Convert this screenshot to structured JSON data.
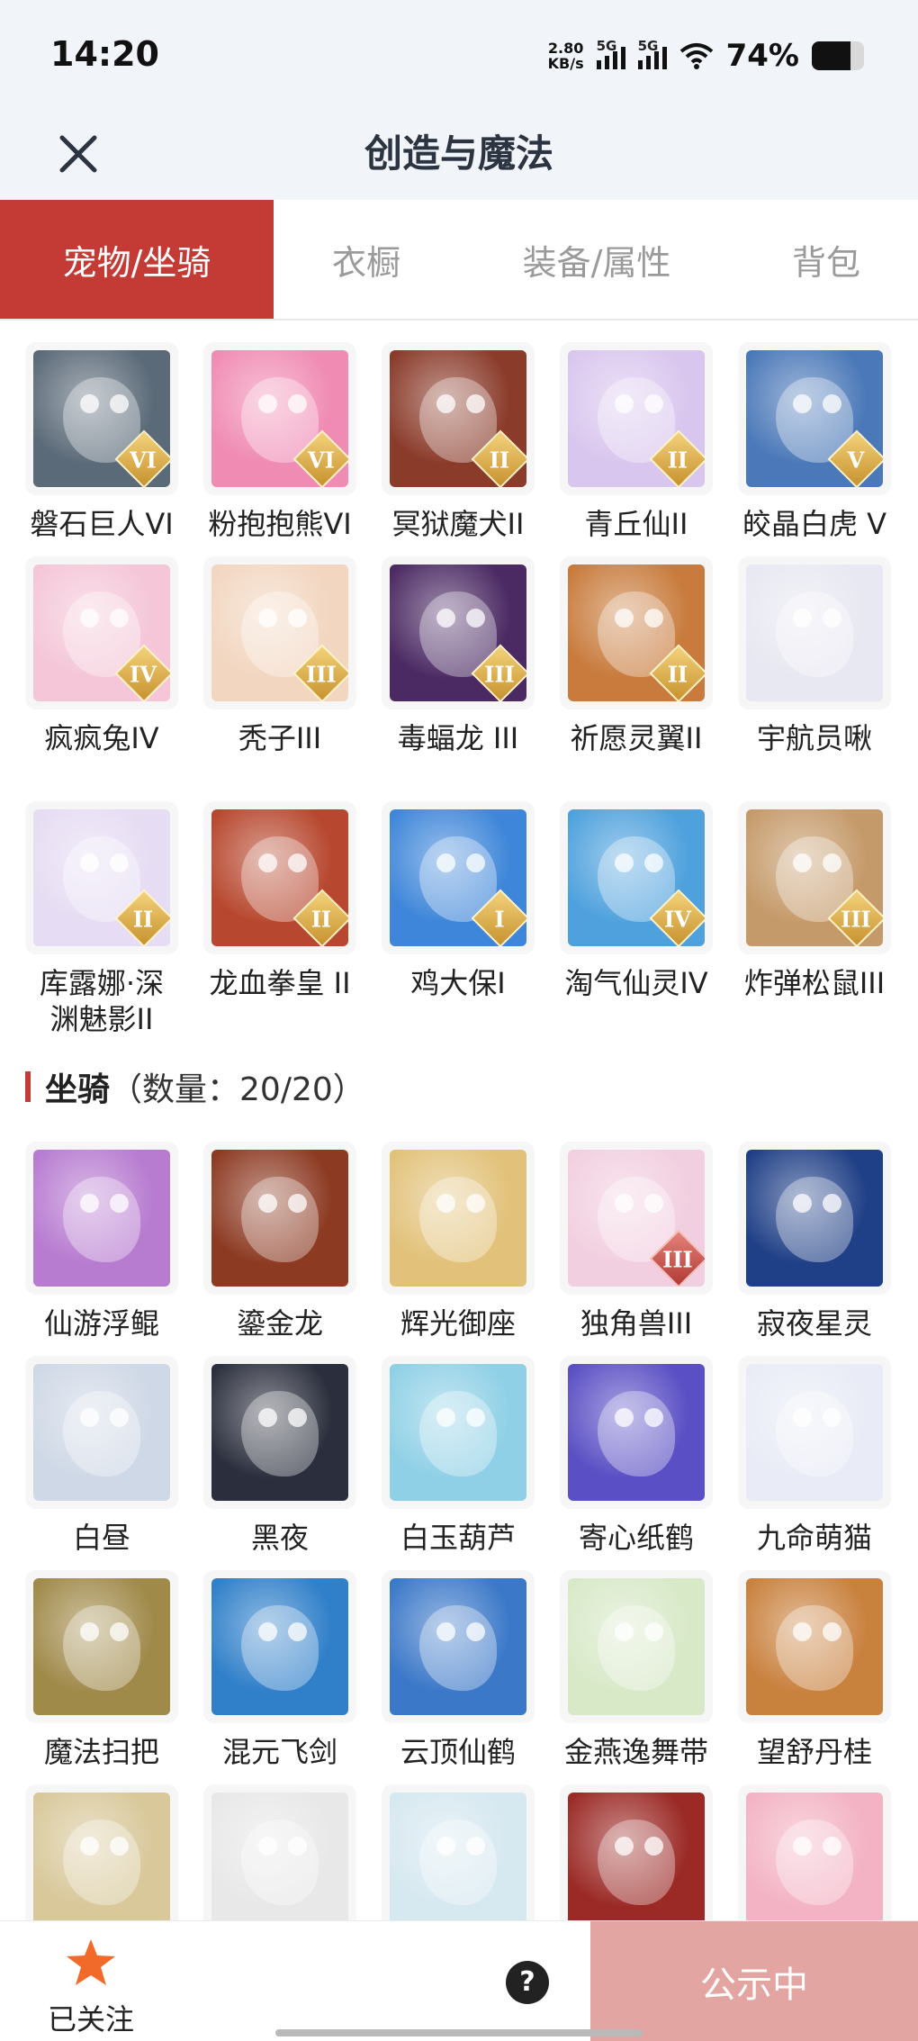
{
  "status_bar": {
    "time": "14:20",
    "net_speed_value": "2.80",
    "net_speed_unit": "KB/s",
    "signal1_label": "5G",
    "signal2_label": "5G",
    "battery_percent": "74%",
    "battery_level": 0.74,
    "icons": [
      "signal-icon",
      "wifi-icon",
      "battery-icon"
    ]
  },
  "header": {
    "title": "创造与魔法",
    "close_icon": "close-icon"
  },
  "tabs": [
    {
      "label": "宠物/坐骑",
      "active": true
    },
    {
      "label": "衣橱",
      "active": false
    },
    {
      "label": "装备/属性",
      "active": false
    },
    {
      "label": "背包",
      "active": false
    }
  ],
  "pets": [
    {
      "name": "磐石巨人VI",
      "badge": "VI",
      "badge_color": "gold",
      "color": "#5b6a78"
    },
    {
      "name": "粉抱抱熊VI",
      "badge": "VI",
      "badge_color": "gold",
      "color": "#f08bb3"
    },
    {
      "name": "冥狱魔犬II",
      "badge": "II",
      "badge_color": "gold",
      "color": "#8a3b2a"
    },
    {
      "name": "青丘仙II",
      "badge": "II",
      "badge_color": "gold",
      "color": "#d9c6ee"
    },
    {
      "name": "皎晶白虎 V",
      "badge": "V",
      "badge_color": "gold",
      "color": "#4a78b8"
    },
    {
      "name": "疯疯兔IV",
      "badge": "IV",
      "badge_color": "gold",
      "color": "#f4c6d7"
    },
    {
      "name": "秃子III",
      "badge": "III",
      "badge_color": "gold",
      "color": "#f2d6c0"
    },
    {
      "name": "毒蝠龙 III",
      "badge": "III",
      "badge_color": "gold",
      "color": "#4b2a63"
    },
    {
      "name": "祈愿灵翼II",
      "badge": "II",
      "badge_color": "gold",
      "color": "#c87b3c"
    },
    {
      "name": "宇航员啾",
      "badge": "",
      "badge_color": "",
      "color": "#e8e8f2"
    },
    {
      "name": "库露娜·深渊魅影II",
      "badge": "II",
      "badge_color": "gold",
      "color": "#e6dcf3"
    },
    {
      "name": "龙血拳皇 II",
      "badge": "II",
      "badge_color": "gold",
      "color": "#b7472e"
    },
    {
      "name": "鸡大保I",
      "badge": "I",
      "badge_color": "gold",
      "color": "#3e86d9"
    },
    {
      "name": "淘气仙灵IV",
      "badge": "IV",
      "badge_color": "gold",
      "color": "#4ea1dd"
    },
    {
      "name": "炸弹松鼠III",
      "badge": "III",
      "badge_color": "gold",
      "color": "#c59a6a"
    }
  ],
  "mounts_section": {
    "title": "坐骑",
    "count": "（数量：20/20）"
  },
  "mounts": [
    {
      "name": "仙游浮鲲",
      "badge": "",
      "badge_color": "",
      "color": "#b77bd0"
    },
    {
      "name": "鎏金龙",
      "badge": "",
      "badge_color": "",
      "color": "#8c3a22"
    },
    {
      "name": "辉光御座",
      "badge": "",
      "badge_color": "",
      "color": "#e2c27a"
    },
    {
      "name": "独角兽III",
      "badge": "III",
      "badge_color": "red",
      "color": "#f2cfe0"
    },
    {
      "name": "寂夜星灵",
      "badge": "",
      "badge_color": "",
      "color": "#1f3f86"
    },
    {
      "name": "白昼",
      "badge": "",
      "badge_color": "",
      "color": "#cfd8e6"
    },
    {
      "name": "黑夜",
      "badge": "",
      "badge_color": "",
      "color": "#2b2f3d"
    },
    {
      "name": "白玉葫芦",
      "badge": "",
      "badge_color": "",
      "color": "#8fd0e6"
    },
    {
      "name": "寄心纸鹤",
      "badge": "",
      "badge_color": "",
      "color": "#5a4fc4"
    },
    {
      "name": "九命萌猫",
      "badge": "",
      "badge_color": "",
      "color": "#e9ecf6"
    },
    {
      "name": "魔法扫把",
      "badge": "",
      "badge_color": "",
      "color": "#a08a4a"
    },
    {
      "name": "混元飞剑",
      "badge": "",
      "badge_color": "",
      "color": "#2f7fc9"
    },
    {
      "name": "云顶仙鹤",
      "badge": "",
      "badge_color": "",
      "color": "#3b78c8"
    },
    {
      "name": "金燕逸舞带",
      "badge": "",
      "badge_color": "",
      "color": "#d8e9c8"
    },
    {
      "name": "望舒丹桂",
      "badge": "",
      "badge_color": "",
      "color": "#c9813e"
    },
    {
      "name": "",
      "badge": "",
      "badge_color": "",
      "color": "#d8c89a"
    },
    {
      "name": "",
      "badge": "",
      "badge_color": "",
      "color": "#e8e8e8"
    },
    {
      "name": "",
      "badge": "",
      "badge_color": "",
      "color": "#d6e8f0"
    },
    {
      "name": "",
      "badge": "",
      "badge_color": "",
      "color": "#9b2a26"
    },
    {
      "name": "",
      "badge": "",
      "badge_color": "",
      "color": "#f3b3c4"
    }
  ],
  "bottom_bar": {
    "follow_label": "已关注",
    "follow_icon": "star-icon",
    "help_icon": "help-icon",
    "help_glyph": "?",
    "public_label": "公示中"
  }
}
